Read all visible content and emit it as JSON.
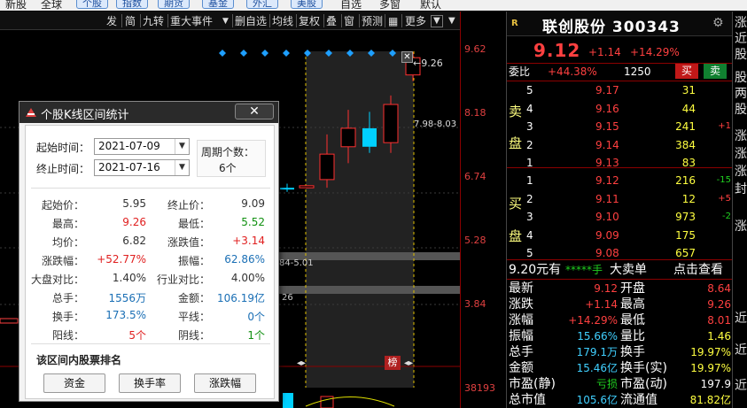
{
  "menubar": {
    "items": [
      "新股",
      "全球",
      "个股",
      "指数",
      "期货",
      "基金",
      "外汇",
      "美股",
      "自选",
      "多窗",
      "默认"
    ]
  },
  "toolbar": {
    "buttons": [
      "发",
      "简",
      "九转",
      "重大事件",
      "删自选",
      "均线",
      "复权",
      "叠",
      "窗",
      "预测",
      "更多"
    ]
  },
  "chart": {
    "y_labels": [
      "9.62",
      "8.18",
      "6.74",
      "5.28",
      "3.84",
      "38193"
    ],
    "annotation_926": "9.26",
    "annotation_range": "7.98-8.03",
    "annotation_low": "84-5.01",
    "annotation_26": "26",
    "marker": "榜",
    "chart_data": {
      "type": "candlestick",
      "candles": [
        {
          "open": 5.95,
          "close": 5.95,
          "high": 6.05,
          "low": 5.85,
          "color": "cyan"
        },
        {
          "open": 5.95,
          "close": 6.0,
          "high": 6.0,
          "low": 5.95,
          "color": "red"
        },
        {
          "open": 6.15,
          "close": 6.77,
          "high": 7.25,
          "low": 5.95,
          "color": "red"
        },
        {
          "open": 6.95,
          "close": 7.4,
          "high": 7.85,
          "low": 6.55,
          "color": "red"
        },
        {
          "open": 7.4,
          "close": 6.95,
          "high": 7.8,
          "low": 6.8,
          "color": "cyan"
        },
        {
          "open": 7.05,
          "close": 7.98,
          "high": 8.2,
          "low": 6.8,
          "color": "red"
        },
        {
          "open": 8.7,
          "close": 9.12,
          "high": 9.26,
          "low": 8.55,
          "color": "red"
        }
      ]
    }
  },
  "quote": {
    "title": "联创股份 300343",
    "price": "9.12",
    "change": "+1.14",
    "change_pct": "+14.29%",
    "weibi_label": "委比",
    "weibi_value": "+44.38%",
    "weibi_count": "1250",
    "buy_label": "买",
    "sell_label": "卖",
    "sell_side_label": "卖盘",
    "buy_side_label": "买盘",
    "asks": [
      {
        "level": "5",
        "price": "9.17",
        "vol": "31",
        "delta": ""
      },
      {
        "level": "4",
        "price": "9.16",
        "vol": "44",
        "delta": ""
      },
      {
        "level": "3",
        "price": "9.15",
        "vol": "241",
        "delta": "+1"
      },
      {
        "level": "2",
        "price": "9.14",
        "vol": "384",
        "delta": ""
      },
      {
        "level": "1",
        "price": "9.13",
        "vol": "83",
        "delta": ""
      }
    ],
    "bids": [
      {
        "level": "1",
        "price": "9.12",
        "vol": "216",
        "delta": "-15"
      },
      {
        "level": "2",
        "price": "9.11",
        "vol": "12",
        "delta": "+5"
      },
      {
        "level": "3",
        "price": "9.10",
        "vol": "973",
        "delta": "-2"
      },
      {
        "level": "4",
        "price": "9.09",
        "vol": "175",
        "delta": ""
      },
      {
        "level": "5",
        "price": "9.08",
        "vol": "657",
        "delta": ""
      }
    ],
    "bigorder": {
      "left": "9.20元有",
      "stars": "*****手",
      "mid": "大卖单",
      "right": "点击查看"
    },
    "stats": [
      {
        "l1": "最新",
        "v1": "9.12",
        "l2": "开盘",
        "v2": "8.64"
      },
      {
        "l1": "涨跌",
        "v1": "+1.14",
        "l2": "最高",
        "v2": "9.26"
      },
      {
        "l1": "涨幅",
        "v1": "+14.29%",
        "l2": "最低",
        "v2": "8.01"
      },
      {
        "l1": "振幅",
        "v1": "15.66%",
        "l2": "量比",
        "v2": "1.46"
      },
      {
        "l1": "总手",
        "v1": "179.1万",
        "l2": "换手",
        "v2": "19.97%"
      },
      {
        "l1": "金额",
        "v1": "15.46亿",
        "l2": "换手(实)",
        "v2": "19.97%"
      },
      {
        "l1": "市盈(静)",
        "v1": "亏损",
        "l2": "市盈(动)",
        "v2": "197.9"
      },
      {
        "l1": "总市值",
        "v1": "105.6亿",
        "l2": "流通值",
        "v2": "81.82亿"
      }
    ]
  },
  "edge": {
    "chars": [
      "涨",
      "近",
      "股",
      "股",
      "两",
      "股",
      "涨",
      "涨",
      "涨",
      "封",
      "涨",
      "近",
      "近",
      "近"
    ]
  },
  "dialog": {
    "title": "个股K线区间统计",
    "start_label": "起始时间：",
    "start_date": "2021-07-09",
    "end_label": "终止时间：",
    "end_date": "2021-07-16",
    "period_label": "周期个数：",
    "period_value": "6个",
    "stats": [
      {
        "l1": "起始价：",
        "v1": "5.95",
        "l2": "终止价：",
        "v2": "9.09"
      },
      {
        "l1": "最高：",
        "v1": "9.26",
        "l2": "最低：",
        "v2": "5.52"
      },
      {
        "l1": "均价：",
        "v1": "6.82",
        "l2": "涨跌值：",
        "v2": "+3.14"
      },
      {
        "l1": "涨跌幅：",
        "v1": "+52.77%",
        "l2": "振幅：",
        "v2": "62.86%"
      },
      {
        "l1": "大盘对比：",
        "v1": "1.40%",
        "l2": "行业对比：",
        "v2": "4.00%"
      },
      {
        "l1": "总手：",
        "v1": "1556万",
        "l2": "金额：",
        "v2": "106.19亿"
      },
      {
        "l1": "换手：",
        "v1": "173.5%",
        "l2": "平线：",
        "v2": "0个"
      },
      {
        "l1": "阳线：",
        "v1": "5个",
        "l2": "阴线：",
        "v2": "1个"
      }
    ],
    "rank_title": "该区间内股票排名",
    "rank_buttons": [
      "资金",
      "换手率",
      "涨跌幅"
    ]
  }
}
